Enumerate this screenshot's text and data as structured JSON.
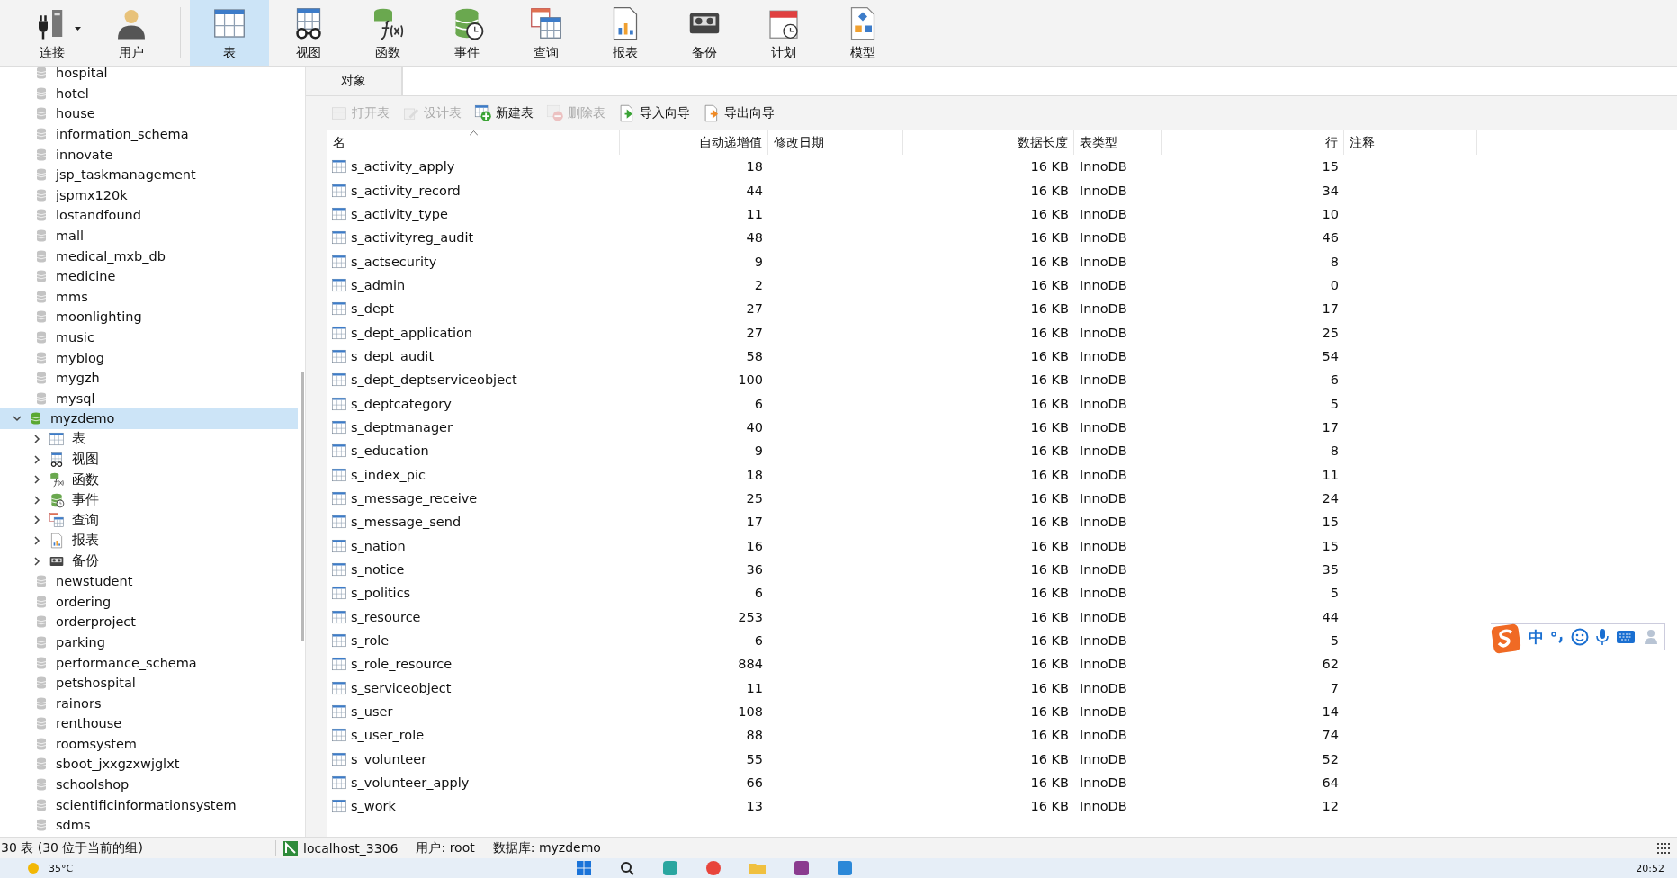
{
  "toolbar": [
    {
      "label": "连接",
      "kind": "connect",
      "selected": false,
      "dropdown": true
    },
    {
      "label": "用户",
      "kind": "user",
      "selected": false
    },
    {
      "label": "表",
      "kind": "table",
      "selected": true
    },
    {
      "label": "视图",
      "kind": "view",
      "selected": false
    },
    {
      "label": "函数",
      "kind": "function",
      "selected": false
    },
    {
      "label": "事件",
      "kind": "event",
      "selected": false
    },
    {
      "label": "查询",
      "kind": "query",
      "selected": false
    },
    {
      "label": "报表",
      "kind": "report",
      "selected": false
    },
    {
      "label": "备份",
      "kind": "backup",
      "selected": false
    },
    {
      "label": "计划",
      "kind": "schedule",
      "selected": false
    },
    {
      "label": "模型",
      "kind": "model",
      "selected": false
    }
  ],
  "sidebar": {
    "items": [
      {
        "label": "hospital",
        "selected": false
      },
      {
        "label": "hotel",
        "selected": false
      },
      {
        "label": "house",
        "selected": false
      },
      {
        "label": "information_schema",
        "selected": false
      },
      {
        "label": "innovate",
        "selected": false
      },
      {
        "label": "jsp_taskmanagement",
        "selected": false
      },
      {
        "label": "jspmx120k",
        "selected": false
      },
      {
        "label": "lostandfound",
        "selected": false
      },
      {
        "label": "mall",
        "selected": false
      },
      {
        "label": "medical_mxb_db",
        "selected": false
      },
      {
        "label": "medicine",
        "selected": false
      },
      {
        "label": "mms",
        "selected": false
      },
      {
        "label": "moonlighting",
        "selected": false
      },
      {
        "label": "music",
        "selected": false
      },
      {
        "label": "myblog",
        "selected": false
      },
      {
        "label": "mygzh",
        "selected": false
      },
      {
        "label": "mysql",
        "selected": false
      },
      {
        "label": "myzdemo",
        "selected": true,
        "expanded": true,
        "children": [
          {
            "label": "表",
            "kind": "table",
            "expanded": false
          },
          {
            "label": "视图",
            "kind": "view",
            "expanded": false
          },
          {
            "label": "函数",
            "kind": "function",
            "expanded": false
          },
          {
            "label": "事件",
            "kind": "event",
            "expanded": false
          },
          {
            "label": "查询",
            "kind": "query",
            "expanded": false
          },
          {
            "label": "报表",
            "kind": "report",
            "expanded": false
          },
          {
            "label": "备份",
            "kind": "backup",
            "expanded": false
          }
        ]
      },
      {
        "label": "newstudent",
        "selected": false
      },
      {
        "label": "ordering",
        "selected": false
      },
      {
        "label": "orderproject",
        "selected": false
      },
      {
        "label": "parking",
        "selected": false
      },
      {
        "label": "performance_schema",
        "selected": false
      },
      {
        "label": "petshospital",
        "selected": false
      },
      {
        "label": "rainors",
        "selected": false
      },
      {
        "label": "renthouse",
        "selected": false
      },
      {
        "label": "roomsystem",
        "selected": false
      },
      {
        "label": "sboot_jxxgzxwjglxt",
        "selected": false
      },
      {
        "label": "schoolshop",
        "selected": false
      },
      {
        "label": "scientificinformationsystem",
        "selected": false
      },
      {
        "label": "sdms",
        "selected": false
      }
    ]
  },
  "tabs": [
    {
      "label": "对象",
      "selected": true
    }
  ],
  "actions": [
    {
      "label": "打开表",
      "kind": "open",
      "disabled": true
    },
    {
      "label": "设计表",
      "kind": "design",
      "disabled": true
    },
    {
      "label": "新建表",
      "kind": "new",
      "disabled": false
    },
    {
      "label": "删除表",
      "kind": "delete",
      "disabled": true
    },
    {
      "label": "导入向导",
      "kind": "import",
      "disabled": false
    },
    {
      "label": "导出向导",
      "kind": "export",
      "disabled": false
    }
  ],
  "table": {
    "columns": [
      "名",
      "自动递增值",
      "修改日期",
      "数据长度",
      "表类型",
      "行",
      "注释"
    ],
    "rows": [
      {
        "name": "s_activity_apply",
        "auto_increment": "18",
        "data_length": "16 KB",
        "engine": "InnoDB",
        "rows": "15"
      },
      {
        "name": "s_activity_record",
        "auto_increment": "44",
        "data_length": "16 KB",
        "engine": "InnoDB",
        "rows": "34"
      },
      {
        "name": "s_activity_type",
        "auto_increment": "11",
        "data_length": "16 KB",
        "engine": "InnoDB",
        "rows": "10"
      },
      {
        "name": "s_activityreg_audit",
        "auto_increment": "48",
        "data_length": "16 KB",
        "engine": "InnoDB",
        "rows": "46"
      },
      {
        "name": "s_actsecurity",
        "auto_increment": "9",
        "data_length": "16 KB",
        "engine": "InnoDB",
        "rows": "8"
      },
      {
        "name": "s_admin",
        "auto_increment": "2",
        "data_length": "16 KB",
        "engine": "InnoDB",
        "rows": "0"
      },
      {
        "name": "s_dept",
        "auto_increment": "27",
        "data_length": "16 KB",
        "engine": "InnoDB",
        "rows": "17"
      },
      {
        "name": "s_dept_application",
        "auto_increment": "27",
        "data_length": "16 KB",
        "engine": "InnoDB",
        "rows": "25"
      },
      {
        "name": "s_dept_audit",
        "auto_increment": "58",
        "data_length": "16 KB",
        "engine": "InnoDB",
        "rows": "54"
      },
      {
        "name": "s_dept_deptserviceobject",
        "auto_increment": "100",
        "data_length": "16 KB",
        "engine": "InnoDB",
        "rows": "6"
      },
      {
        "name": "s_deptcategory",
        "auto_increment": "6",
        "data_length": "16 KB",
        "engine": "InnoDB",
        "rows": "5"
      },
      {
        "name": "s_deptmanager",
        "auto_increment": "40",
        "data_length": "16 KB",
        "engine": "InnoDB",
        "rows": "17"
      },
      {
        "name": "s_education",
        "auto_increment": "9",
        "data_length": "16 KB",
        "engine": "InnoDB",
        "rows": "8"
      },
      {
        "name": "s_index_pic",
        "auto_increment": "18",
        "data_length": "16 KB",
        "engine": "InnoDB",
        "rows": "11"
      },
      {
        "name": "s_message_receive",
        "auto_increment": "25",
        "data_length": "16 KB",
        "engine": "InnoDB",
        "rows": "24"
      },
      {
        "name": "s_message_send",
        "auto_increment": "17",
        "data_length": "16 KB",
        "engine": "InnoDB",
        "rows": "15"
      },
      {
        "name": "s_nation",
        "auto_increment": "16",
        "data_length": "16 KB",
        "engine": "InnoDB",
        "rows": "15"
      },
      {
        "name": "s_notice",
        "auto_increment": "36",
        "data_length": "16 KB",
        "engine": "InnoDB",
        "rows": "35"
      },
      {
        "name": "s_politics",
        "auto_increment": "6",
        "data_length": "16 KB",
        "engine": "InnoDB",
        "rows": "5"
      },
      {
        "name": "s_resource",
        "auto_increment": "253",
        "data_length": "16 KB",
        "engine": "InnoDB",
        "rows": "44"
      },
      {
        "name": "s_role",
        "auto_increment": "6",
        "data_length": "16 KB",
        "engine": "InnoDB",
        "rows": "5"
      },
      {
        "name": "s_role_resource",
        "auto_increment": "884",
        "data_length": "16 KB",
        "engine": "InnoDB",
        "rows": "62"
      },
      {
        "name": "s_serviceobject",
        "auto_increment": "11",
        "data_length": "16 KB",
        "engine": "InnoDB",
        "rows": "7"
      },
      {
        "name": "s_user",
        "auto_increment": "108",
        "data_length": "16 KB",
        "engine": "InnoDB",
        "rows": "14"
      },
      {
        "name": "s_user_role",
        "auto_increment": "88",
        "data_length": "16 KB",
        "engine": "InnoDB",
        "rows": "74"
      },
      {
        "name": "s_volunteer",
        "auto_increment": "55",
        "data_length": "16 KB",
        "engine": "InnoDB",
        "rows": "52"
      },
      {
        "name": "s_volunteer_apply",
        "auto_increment": "66",
        "data_length": "16 KB",
        "engine": "InnoDB",
        "rows": "64"
      },
      {
        "name": "s_work",
        "auto_increment": "13",
        "data_length": "16 KB",
        "engine": "InnoDB",
        "rows": "12"
      }
    ]
  },
  "status_bar": {
    "summary": "30 表 (30 位于当前的组)",
    "host": "localhost_3306",
    "user": "用户: root",
    "database": "数据库: myzdemo"
  },
  "ime_bar": {
    "mode": "中"
  },
  "taskbar": {
    "weather": "35°C",
    "time": "20:52"
  }
}
